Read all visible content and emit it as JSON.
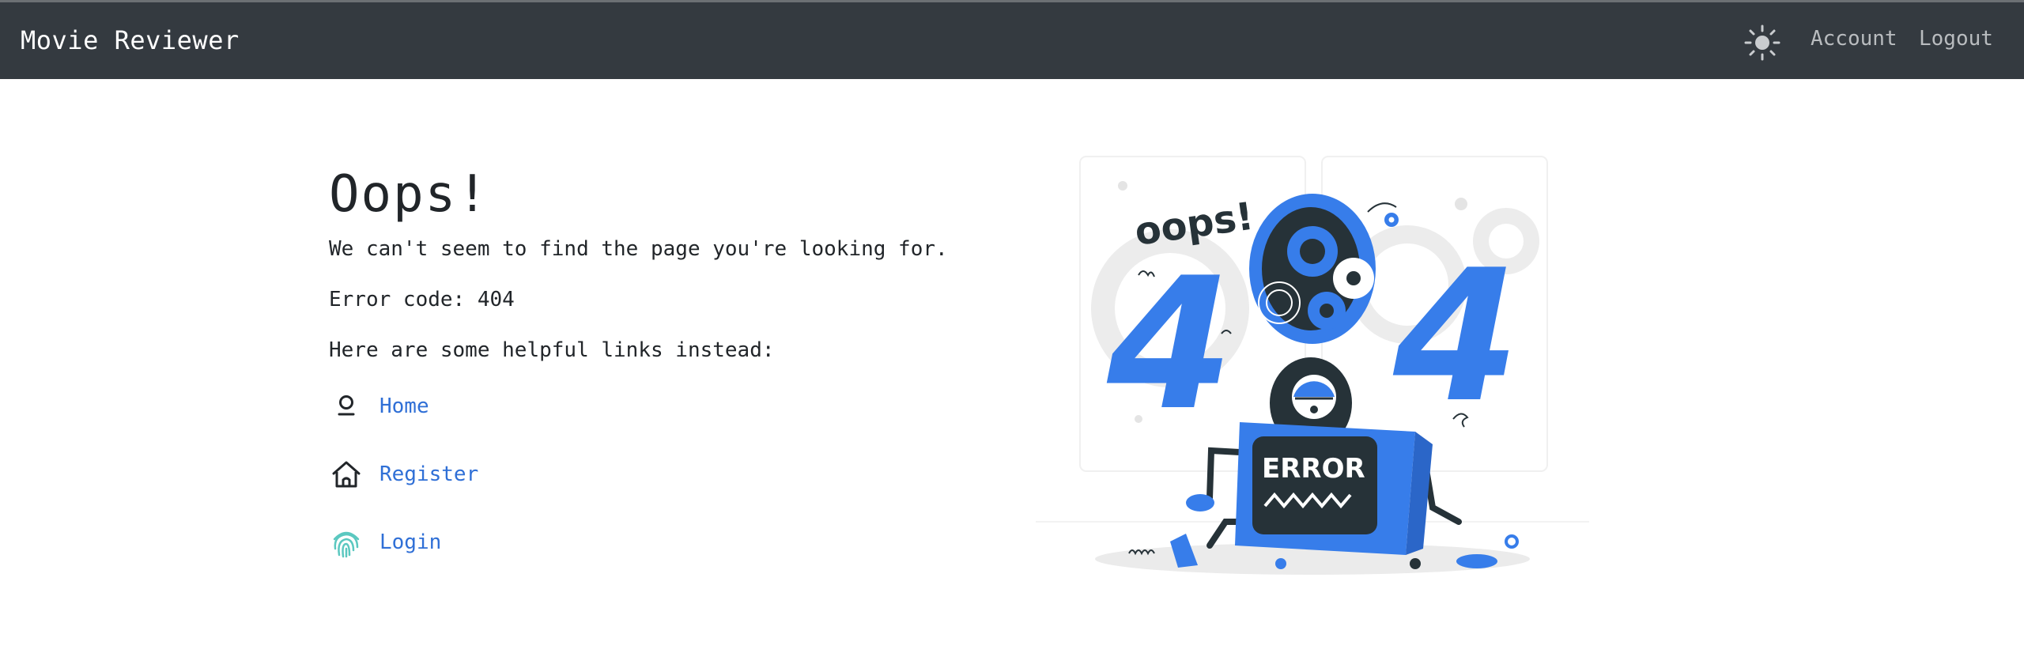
{
  "app": {
    "brand": "Movie Reviewer"
  },
  "nav": {
    "theme_icon": "sun-icon",
    "account_label": "Account",
    "logout_label": "Logout"
  },
  "error_page": {
    "title": "Oops!",
    "message": "We can't seem to find the page you're looking for.",
    "error_code_text": "Error code: 404",
    "links_intro": "Here are some helpful links instead:",
    "links": [
      {
        "label": "Home",
        "icon": "person-pin-icon"
      },
      {
        "label": "Register",
        "icon": "house-icon"
      },
      {
        "label": "Login",
        "icon": "fingerprint-icon"
      }
    ]
  },
  "illustration": {
    "oops_text": "oops!",
    "error_text": "ERROR",
    "digit_left": "4",
    "digit_right": "4"
  },
  "colors": {
    "navbar_bg": "#343a40",
    "link": "#2f6fd6",
    "illustration_blue": "#377dea",
    "illustration_dark": "#263238",
    "fingerprint_teal": "#5bc8c0"
  }
}
